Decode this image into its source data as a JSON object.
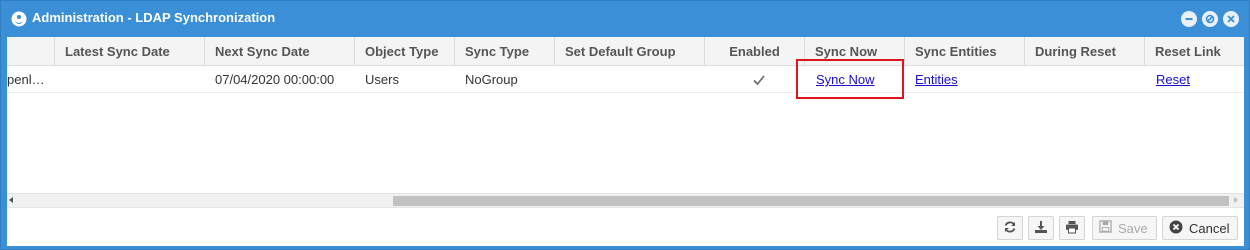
{
  "window": {
    "title": "Administration - LDAP Synchronization",
    "controls": [
      "minimize-icon",
      "restore-icon",
      "close-icon"
    ],
    "accent": "#3a8fd6"
  },
  "grid": {
    "columns": [
      {
        "label": ""
      },
      {
        "label": "Latest Sync Date"
      },
      {
        "label": "Next Sync Date"
      },
      {
        "label": "Object Type"
      },
      {
        "label": "Sync Type"
      },
      {
        "label": "Set Default Group"
      },
      {
        "label": "Enabled"
      },
      {
        "label": "Sync Now"
      },
      {
        "label": "Sync Entities"
      },
      {
        "label": "During Reset"
      },
      {
        "label": "Reset Link"
      }
    ],
    "rows": [
      {
        "name": "penl…",
        "latest_sync_date": "",
        "next_sync_date": "07/04/2020 00:00:00",
        "object_type": "Users",
        "sync_type": "NoGroup",
        "set_default_group": "",
        "enabled": true,
        "sync_now": "Sync Now",
        "sync_entities": "Entities",
        "during_reset": "",
        "reset_link": "Reset"
      }
    ]
  },
  "footer": {
    "buttons": [
      "refresh-icon",
      "download-icon",
      "print-icon"
    ],
    "save_label": "Save",
    "save_enabled": false,
    "cancel_label": "Cancel"
  },
  "colors": {
    "highlight": "#e0141e",
    "link": "#1a0dcc"
  }
}
